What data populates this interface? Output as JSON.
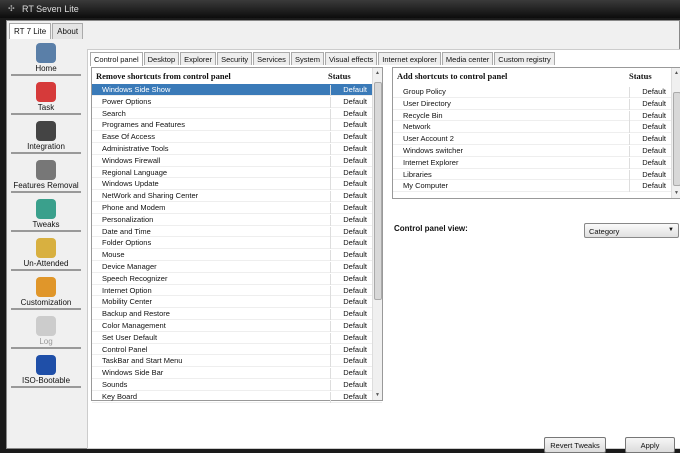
{
  "window": {
    "title": "RT Seven Lite"
  },
  "top_tabs": [
    "RT 7 Lite",
    "About"
  ],
  "sidebar": [
    {
      "label": "Home",
      "icon": "home-icon",
      "color": "#5a7fa8"
    },
    {
      "label": "Task",
      "icon": "task-icon",
      "color": "#d63a3a"
    },
    {
      "label": "Integration",
      "icon": "integration-icon",
      "color": "#444"
    },
    {
      "label": "Features Removal",
      "icon": "features-removal-icon",
      "color": "#777"
    },
    {
      "label": "Tweaks",
      "icon": "tweaks-icon",
      "color": "#3aa08c"
    },
    {
      "label": "Un-Attended",
      "icon": "unattended-icon",
      "color": "#d8b040"
    },
    {
      "label": "Customization",
      "icon": "customization-icon",
      "color": "#e0962a"
    },
    {
      "label": "Log",
      "icon": "log-icon",
      "color": "#ccc",
      "disabled": true
    },
    {
      "label": "ISO-Bootable",
      "icon": "iso-bootable-icon",
      "color": "#1f4fa8"
    }
  ],
  "content_tabs": [
    "Control panel",
    "Desktop",
    "Explorer",
    "Security",
    "Services",
    "System",
    "Visual effects",
    "Internet explorer",
    "Media center",
    "Custom registry"
  ],
  "left": {
    "title": "Remove shortcuts from control panel",
    "status_header": "Status",
    "items": [
      "Windows Side Show",
      "Power Options",
      "Search",
      "Programes and Features",
      "Ease Of Access",
      "Administrative Tools",
      "Windows Firewall",
      "Regional Language",
      "Windows Update",
      "NetWork and Sharing Center",
      "Phone and Modem",
      "Personalization",
      "Date and Time",
      "Folder Options",
      "Mouse",
      "Device Manager",
      "Speech Recognizer",
      "Internet Option",
      "Mobility Center",
      "Backup and Restore",
      "Color Management",
      "Set User Default",
      "Control Panel",
      "TaskBar and Start Menu",
      "Windows Side Bar",
      "Sounds",
      "Key Board"
    ],
    "status": "Default"
  },
  "right": {
    "title": "Add shortcuts to control panel",
    "status_header": "Status",
    "items": [
      "Group Policy",
      "User Directory",
      "Recycle Bin",
      "Network",
      "User Account 2",
      "Windows switcher",
      "Internet Explorer",
      "Libraries",
      "My Computer"
    ],
    "status": "Default"
  },
  "view": {
    "label": "Control panel view:",
    "value": "Category"
  },
  "buttons": {
    "revert": "Revert Tweaks",
    "apply": "Apply"
  }
}
